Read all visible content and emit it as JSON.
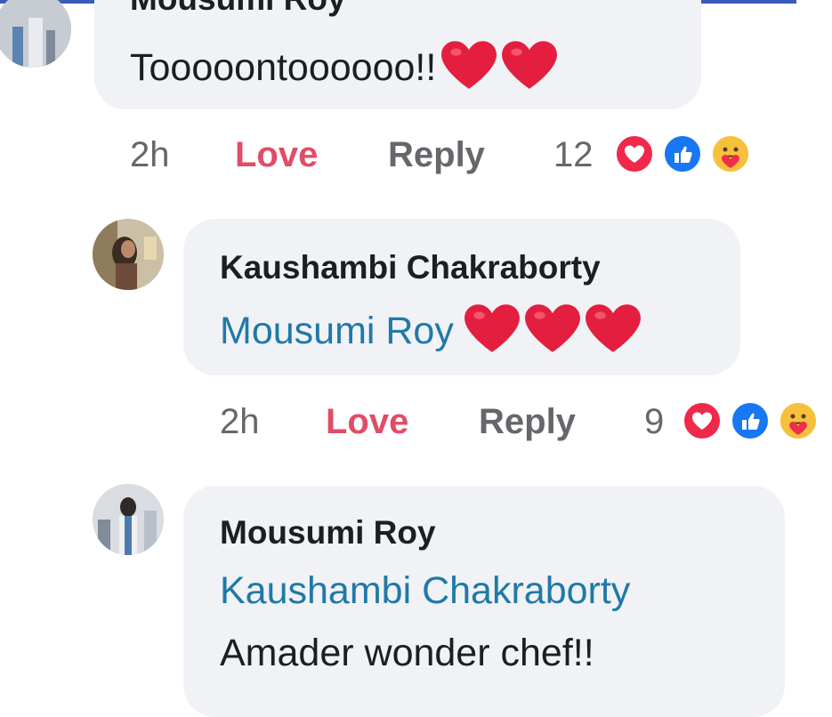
{
  "comments": [
    {
      "author": "Mousumi Roy",
      "text": "Tooooontoooooo!!",
      "time": "2h",
      "love_label": "Love",
      "reply_label": "Reply",
      "reaction_count": "12",
      "emoji": [
        "red-heart",
        "red-heart"
      ],
      "reactions": [
        "love-reaction",
        "like-reaction",
        "care-reaction"
      ]
    },
    {
      "author": "Kaushambi Chakraborty",
      "mention": "Mousumi Roy",
      "time": "2h",
      "love_label": "Love",
      "reply_label": "Reply",
      "reaction_count": "9",
      "emoji": [
        "red-heart",
        "red-heart",
        "red-heart"
      ],
      "reactions": [
        "love-reaction",
        "like-reaction",
        "care-reaction"
      ]
    },
    {
      "author": "Mousumi Roy",
      "mention": "Kaushambi Chakraborty",
      "text": "Amader wonder chef!!"
    }
  ],
  "colors": {
    "love": "#e04d66",
    "mention": "#2079a8",
    "bubble": "#f0f2f5",
    "like": "#1877f2",
    "heart": "#e41e3f"
  }
}
